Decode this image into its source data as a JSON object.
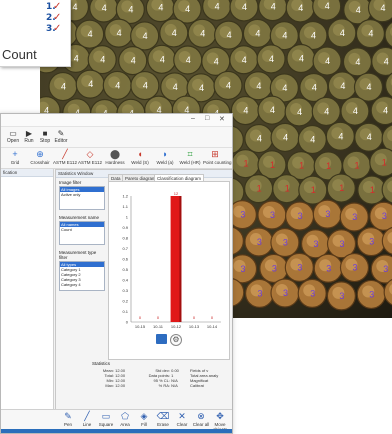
{
  "count_badge": {
    "numbers": [
      "1.",
      "2.",
      "3."
    ],
    "check": "✓",
    "label": "Count",
    "colors": {
      "number": "#1a4fa0",
      "check": "#c8372d"
    }
  },
  "micrograph": {
    "upper_label": "4",
    "middle_label": "1",
    "lower_label": "3",
    "colors": {
      "upper": "#ffffff",
      "middle": "#d62b2b",
      "lower": "#6f3fd8"
    }
  },
  "window": {
    "controls": [
      "–",
      "□",
      "✕"
    ],
    "toolbar1": [
      {
        "icon": "open-icon",
        "label": "Open"
      },
      {
        "icon": "run-icon",
        "label": "Run"
      },
      {
        "icon": "stop-icon",
        "label": "Stop"
      },
      {
        "icon": "editor-icon",
        "label": "Editor"
      }
    ],
    "toolbar2": [
      {
        "icon": "grid-icon",
        "label": "Grid"
      },
      {
        "icon": "crosshair-icon",
        "label": "Crosshair"
      },
      {
        "icon": "astm-e112-icon",
        "label": "ASTM E112"
      },
      {
        "icon": "astm-e112b-icon",
        "label": "ASTM E112"
      },
      {
        "icon": "hardness-icon",
        "label": "Hardness"
      },
      {
        "icon": "weld-s-icon",
        "label": "Weld (S)"
      },
      {
        "icon": "weld-a-icon",
        "label": "Weld (a)"
      },
      {
        "icon": "weld-hr-icon",
        "label": "Weld (HR)"
      },
      {
        "icon": "point-counting-icon",
        "label": "Point counting"
      }
    ],
    "left_panel_title": "fication",
    "stats_title": "Statistics Window"
  },
  "stats": {
    "image_filter_title": "Image filter",
    "image_filter_items": [
      "All images",
      "Active only"
    ],
    "measurement_name_title": "Measurement name",
    "measurement_name_items": [
      "All names",
      "Count"
    ],
    "measurement_type_title": "Measurement type filter",
    "measurement_type_items": [
      "All types",
      "Category 1",
      "Category 2",
      "Category 3",
      "Category 4"
    ],
    "tabs": [
      "Data",
      "Pareto diagram",
      "Classification diagram"
    ],
    "active_tab": 2,
    "summary_title": "Statistics",
    "summary_left": [
      {
        "k": "Mean:",
        "v": "12.00"
      },
      {
        "k": "Total:",
        "v": "12.00"
      },
      {
        "k": "Min:",
        "v": "12.00"
      },
      {
        "k": "Max:",
        "v": "12.00"
      }
    ],
    "summary_mid": [
      {
        "k": "Std dev:",
        "v": "0.00"
      },
      {
        "k": "Data points:",
        "v": "1"
      },
      {
        "k": "95 % CL:",
        "v": "N/A"
      },
      {
        "k": "% RA:",
        "v": "N/A"
      }
    ],
    "summary_right": [
      "Fields of v",
      "Total area analy",
      "Magnificat",
      "Calibrat"
    ]
  },
  "chart_data": {
    "type": "bar",
    "categories": [
      "10-15",
      "10-11",
      "10-12",
      "10-13",
      "10-14"
    ],
    "values": [
      0,
      0,
      12,
      0,
      0
    ],
    "ylim": [
      0,
      1.2
    ],
    "yticks": [
      "1.2",
      "1.1",
      "1",
      "0.9",
      "0.8",
      "0.7",
      "0.6",
      "0.5",
      "0.4",
      "0.3",
      "0.2",
      "0.1",
      "0"
    ],
    "data_labels": [
      "0",
      "0",
      "12",
      "0",
      "0"
    ],
    "bar_color": "#e01818"
  },
  "bottom_toolbar": [
    {
      "icon": "pen-icon",
      "label": "Pen"
    },
    {
      "icon": "line-icon",
      "label": "Line"
    },
    {
      "icon": "square-icon",
      "label": "Square"
    },
    {
      "icon": "area-icon",
      "label": "Area"
    },
    {
      "icon": "fill-icon",
      "label": "Fill"
    },
    {
      "icon": "erase-icon",
      "label": "Erase"
    },
    {
      "icon": "clear-icon",
      "label": "Clear"
    },
    {
      "icon": "clear-all-icon",
      "label": "Clear all"
    },
    {
      "icon": "move-objects-icon",
      "label": "Move objects"
    }
  ]
}
